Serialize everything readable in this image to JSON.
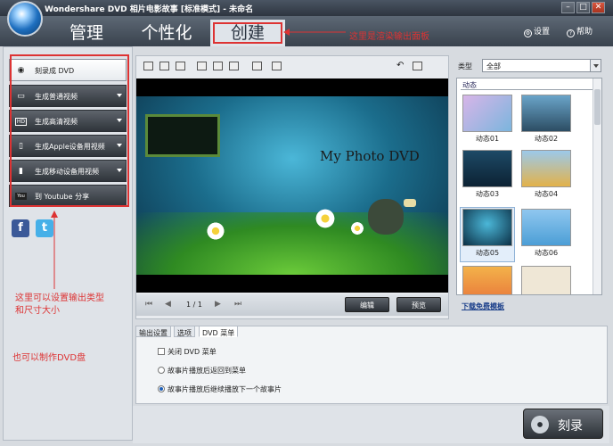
{
  "window": {
    "title": "Wondershare DVD 相片电影故事 [标准模式] - 未命名",
    "minimize": "–",
    "maximize": "□",
    "close": "✕"
  },
  "header": {
    "tabs": [
      {
        "label": "管理"
      },
      {
        "label": "个性化"
      },
      {
        "label": "创建"
      }
    ],
    "settings_label": "设置",
    "help_label": "帮助"
  },
  "annotations": {
    "render_panel": "这里是渲染输出面板",
    "output_type": "这里可以设置输出类型\n和尺寸大小",
    "dvd_disc": "也可以制作DVD盘"
  },
  "output_options": [
    {
      "label": "刻录成 DVD",
      "icon": "disc-icon"
    },
    {
      "label": "生成普通视频",
      "icon": "monitor-icon"
    },
    {
      "label": "生成高清视频",
      "icon": "hd-icon"
    },
    {
      "label": "生成Apple设备用视频",
      "icon": "phone-icon"
    },
    {
      "label": "生成移动设备用视频",
      "icon": "mobile-icon"
    },
    {
      "label": "到 Youtube 分享",
      "icon": "youtube-icon"
    }
  ],
  "social": {
    "facebook": "f",
    "twitter": "t"
  },
  "preview": {
    "dvd_title": "My Photo DVD",
    "page_indicator": "1 / 1",
    "edit_label": "编辑",
    "preview_label": "预览"
  },
  "templates": {
    "type_label": "类型",
    "type_value": "全部",
    "category": "动态",
    "items": [
      {
        "label": "动态01"
      },
      {
        "label": "动态02"
      },
      {
        "label": "动态03"
      },
      {
        "label": "动态04"
      },
      {
        "label": "动态05"
      },
      {
        "label": "动态06"
      }
    ],
    "download_link": "下载免费模板"
  },
  "settings": {
    "tabs": [
      {
        "label": "输出设置"
      },
      {
        "label": "选项"
      },
      {
        "label": "DVD 菜单"
      }
    ],
    "close_menu": "关闭 DVD 菜单",
    "option_return": "故事片播放后返回到菜单",
    "option_next": "故事片播放后继续播放下一个故事片"
  },
  "burn_label": "刻录",
  "colors": {
    "accent_red": "#dd3333",
    "header": "#39424d",
    "link": "#1b3f8a"
  }
}
